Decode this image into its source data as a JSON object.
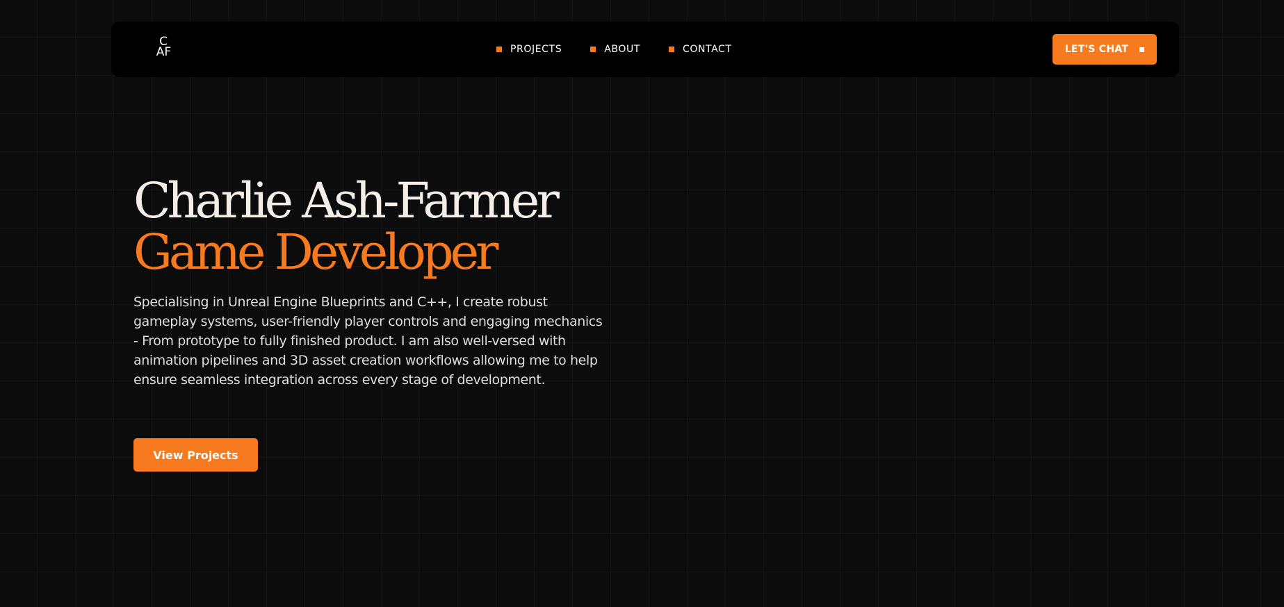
{
  "brand": {
    "logo_line1": "C",
    "logo_line2": "AF"
  },
  "nav": {
    "items": [
      {
        "label": "PROJECTS"
      },
      {
        "label": "ABOUT"
      },
      {
        "label": "CONTACT"
      }
    ],
    "cta_label": "LET'S CHAT"
  },
  "hero": {
    "name": "Charlie Ash-Farmer",
    "role": "Game Developer",
    "description": "Specialising in Unreal Engine Blueprints and C++, I create robust gameplay systems, user-friendly player controls and engaging mechanics - From prototype to fully finished product. I am also well-versed with animation pipelines and 3D asset creation workflows allowing me to help ensure seamless integration across every stage of development.",
    "button_label": "View Projects"
  },
  "colors": {
    "accent": "#f77b1e",
    "background": "#0c0c0c",
    "navbar": "#000000"
  }
}
